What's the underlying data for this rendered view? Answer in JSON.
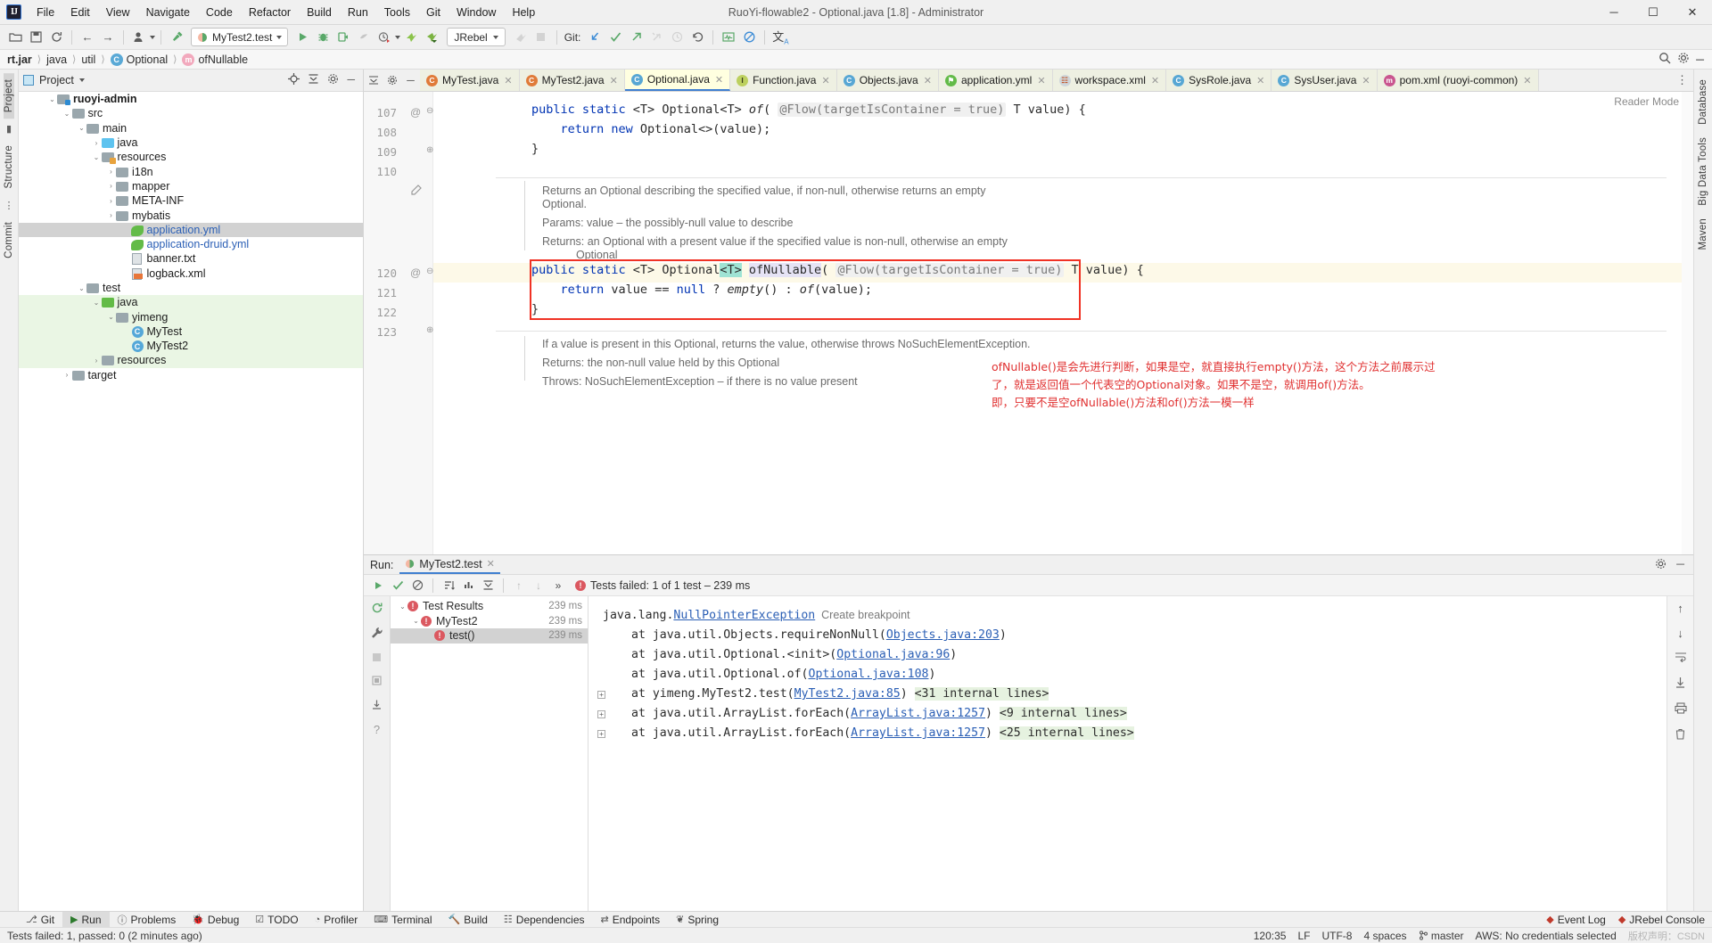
{
  "window": {
    "title": "RuoYi-flowable2 - Optional.java [1.8] - Administrator",
    "logo": "IJ",
    "minimize": "─",
    "maximize": "☐",
    "close": "✕"
  },
  "menubar": [
    "File",
    "Edit",
    "View",
    "Navigate",
    "Code",
    "Refactor",
    "Build",
    "Run",
    "Tools",
    "Git",
    "Window",
    "Help"
  ],
  "toolbar": {
    "run_config": "MyTest2.test",
    "jrebel": "JRebel",
    "git_label": "Git:",
    "icons": [
      "open-folder-icon",
      "save-icon",
      "sync-icon",
      "back-arrow-icon",
      "forward-arrow-icon",
      "user-avatar-icon",
      "build-hammer-icon",
      "run-icon",
      "debug-icon",
      "run-coverage-icon",
      "profiler-icon",
      "run-with-profiler-icon",
      "jrebel-run-icon",
      "jrebel-debug-icon",
      "attach-icon",
      "stop-icon",
      "git-update-icon",
      "git-commit-icon",
      "git-push-icon",
      "git-shelve-icon",
      "history-icon",
      "rollback-icon",
      "activity-monitor-icon",
      "no-access-icon",
      "translate-icon"
    ]
  },
  "breadcrumb": {
    "items": [
      "rt.jar",
      "java",
      "util",
      "Optional",
      "ofNullable"
    ],
    "right_icons": [
      "search-icon",
      "gear-icon",
      "more-icon"
    ]
  },
  "left_rail": {
    "top": [
      "Project",
      "Structure",
      "Commit"
    ],
    "selected": "Project"
  },
  "right_rail": {
    "items": [
      "Database",
      "Big Data Tools",
      "Maven"
    ]
  },
  "project_panel": {
    "title": "Project",
    "tree": [
      {
        "indent": 0,
        "arrow": "⌄",
        "icon": "folder-module-icon",
        "label": "ruoyi-admin",
        "bold": true,
        "sel": false,
        "green": false
      },
      {
        "indent": 1,
        "arrow": "⌄",
        "icon": "folder-icon",
        "label": "src",
        "bold": false,
        "sel": false,
        "green": false
      },
      {
        "indent": 2,
        "arrow": "⌄",
        "icon": "folder-icon",
        "label": "main",
        "bold": false,
        "sel": false,
        "green": false
      },
      {
        "indent": 3,
        "arrow": "›",
        "icon": "folder-source-icon",
        "label": "java",
        "bold": false,
        "sel": false,
        "green": false
      },
      {
        "indent": 3,
        "arrow": "⌄",
        "icon": "folder-resources-icon",
        "label": "resources",
        "bold": false,
        "sel": false,
        "green": false
      },
      {
        "indent": 4,
        "arrow": "›",
        "icon": "folder-icon",
        "label": "i18n",
        "bold": false,
        "sel": false,
        "green": false
      },
      {
        "indent": 4,
        "arrow": "›",
        "icon": "folder-icon",
        "label": "mapper",
        "bold": false,
        "sel": false,
        "green": false
      },
      {
        "indent": 4,
        "arrow": "›",
        "icon": "folder-icon",
        "label": "META-INF",
        "bold": false,
        "sel": false,
        "green": false
      },
      {
        "indent": 4,
        "arrow": "›",
        "icon": "folder-icon",
        "label": "mybatis",
        "bold": false,
        "sel": false,
        "green": false
      },
      {
        "indent": 5,
        "arrow": "",
        "icon": "yaml-file-icon",
        "label": "application.yml",
        "bold": false,
        "sel": true,
        "green": false,
        "link": true
      },
      {
        "indent": 5,
        "arrow": "",
        "icon": "yaml-file-icon",
        "label": "application-druid.yml",
        "bold": false,
        "sel": false,
        "green": false,
        "link": true
      },
      {
        "indent": 5,
        "arrow": "",
        "icon": "text-file-icon",
        "label": "banner.txt",
        "bold": false,
        "sel": false,
        "green": false
      },
      {
        "indent": 5,
        "arrow": "",
        "icon": "xml-file-icon",
        "label": "logback.xml",
        "bold": false,
        "sel": false,
        "green": false
      },
      {
        "indent": 2,
        "arrow": "⌄",
        "icon": "folder-icon",
        "label": "test",
        "bold": false,
        "sel": false,
        "green": false
      },
      {
        "indent": 3,
        "arrow": "⌄",
        "icon": "folder-test-source-icon",
        "label": "java",
        "bold": false,
        "sel": false,
        "green": true
      },
      {
        "indent": 4,
        "arrow": "⌄",
        "icon": "folder-icon",
        "label": "yimeng",
        "bold": false,
        "sel": false,
        "green": true
      },
      {
        "indent": 5,
        "arrow": "",
        "icon": "java-class-icon",
        "label": "MyTest",
        "bold": false,
        "sel": false,
        "green": true
      },
      {
        "indent": 5,
        "arrow": "",
        "icon": "java-class-icon",
        "label": "MyTest2",
        "bold": false,
        "sel": false,
        "green": true
      },
      {
        "indent": 3,
        "arrow": "›",
        "icon": "folder-icon",
        "label": "resources",
        "bold": false,
        "sel": false,
        "green": true
      },
      {
        "indent": 1,
        "arrow": "›",
        "icon": "folder-excluded-icon",
        "label": "target",
        "bold": false,
        "sel": false,
        "green": false
      }
    ]
  },
  "editor": {
    "tabs": [
      {
        "label": "MyTest.java",
        "icon": "java-class-run-icon",
        "kind": "c",
        "active": false
      },
      {
        "label": "MyTest2.java",
        "icon": "java-class-run-icon",
        "kind": "c",
        "active": false
      },
      {
        "label": "Optional.java",
        "icon": "java-class-icon",
        "kind": "cb",
        "active": true
      },
      {
        "label": "Function.java",
        "icon": "java-interface-icon",
        "kind": "i",
        "active": false
      },
      {
        "label": "Objects.java",
        "icon": "java-class-icon",
        "kind": "cb",
        "active": false
      },
      {
        "label": "application.yml",
        "icon": "yaml-file-icon",
        "kind": "y",
        "active": false
      },
      {
        "label": "workspace.xml",
        "icon": "xml-file-icon",
        "kind": "x",
        "active": false
      },
      {
        "label": "SysRole.java",
        "icon": "java-class-icon",
        "kind": "cb",
        "active": false
      },
      {
        "label": "SysUser.java",
        "icon": "java-class-icon",
        "kind": "cb",
        "active": false
      },
      {
        "label": "pom.xml (ruoyi-common)",
        "icon": "maven-file-icon",
        "kind": "m",
        "active": false
      }
    ],
    "reader_mode": "Reader Mode",
    "line_numbers": [
      "107",
      "108",
      "109",
      "110",
      "120",
      "121",
      "122",
      "123"
    ],
    "javadoc_top": [
      "Returns an Optional describing the specified value, if non-null, otherwise returns an empty",
      "Optional.",
      "Params:  value – the possibly-null value to describe",
      "Returns: an Optional with a present value if the specified value is non-null, otherwise an empty",
      "Optional"
    ],
    "javadoc_bottom": [
      "If a value is present in this Optional, returns the value, otherwise throws NoSuchElementException.",
      "Returns:  the non-null value held by this Optional",
      "Throws:  NoSuchElementException – if there is no value present"
    ],
    "annotation_cn": [
      "ofNullable()是会先进行判断，如果是空，就直接执行empty()方法，这个方法之前展示过",
      "了，就是返回值一个代表空的Optional对象。如果不是空，就调用of()方法。",
      "即，只要不是空ofNullable()方法和of()方法一模一样"
    ]
  },
  "run_panel": {
    "label": "Run:",
    "tab": "MyTest2.test",
    "status": "Tests failed: 1 of 1 test – 239 ms",
    "tree": [
      {
        "indent": 0,
        "arrow": "⌄",
        "label": "Test Results",
        "time": "239 ms",
        "sel": false
      },
      {
        "indent": 1,
        "arrow": "⌄",
        "label": "MyTest2",
        "time": "239 ms",
        "sel": false
      },
      {
        "indent": 2,
        "arrow": "",
        "label": "test()",
        "time": "239 ms",
        "sel": true
      }
    ],
    "console": [
      {
        "indent": 0,
        "parts": [
          {
            "t": "java.lang.",
            "c": "exc"
          },
          {
            "t": "NullPointerException",
            "c": "lnk"
          },
          {
            "t": "  Create breakpoint",
            "c": "bpt"
          }
        ]
      },
      {
        "indent": 1,
        "parts": [
          {
            "t": "at java.util.Objects.requireNonNull(",
            "c": "exc"
          },
          {
            "t": "Objects.java:203",
            "c": "lnk"
          },
          {
            "t": ")",
            "c": "exc"
          }
        ]
      },
      {
        "indent": 1,
        "parts": [
          {
            "t": "at java.util.Optional.<init>(",
            "c": "exc"
          },
          {
            "t": "Optional.java:96",
            "c": "lnk"
          },
          {
            "t": ")",
            "c": "exc"
          }
        ]
      },
      {
        "indent": 1,
        "parts": [
          {
            "t": "at java.util.Optional.of(",
            "c": "exc"
          },
          {
            "t": "Optional.java:108",
            "c": "lnk"
          },
          {
            "t": ")",
            "c": "exc"
          }
        ]
      },
      {
        "indent": 1,
        "fold": true,
        "parts": [
          {
            "t": "at yimeng.MyTest2.test(",
            "c": "exc"
          },
          {
            "t": "MyTest2.java:85",
            "c": "lnk"
          },
          {
            "t": ") ",
            "c": "exc"
          },
          {
            "t": "<31 internal lines>",
            "c": "ilines"
          }
        ]
      },
      {
        "indent": 1,
        "fold": true,
        "parts": [
          {
            "t": "at java.util.ArrayList.forEach(",
            "c": "exc"
          },
          {
            "t": "ArrayList.java:1257",
            "c": "lnk"
          },
          {
            "t": ") ",
            "c": "exc"
          },
          {
            "t": "<9 internal lines>",
            "c": "ilines"
          }
        ]
      },
      {
        "indent": 1,
        "fold": true,
        "parts": [
          {
            "t": "at java.util.ArrayList.forEach(",
            "c": "exc"
          },
          {
            "t": "ArrayList.java:1257",
            "c": "lnk"
          },
          {
            "t": ") ",
            "c": "exc"
          },
          {
            "t": "<25 internal lines>",
            "c": "ilines"
          }
        ]
      }
    ]
  },
  "tool_windows": {
    "items": [
      {
        "label": "Git",
        "icon": "git-icon",
        "active": false
      },
      {
        "label": "Run",
        "icon": "run-icon",
        "active": true
      },
      {
        "label": "Problems",
        "icon": "problems-icon",
        "active": false
      },
      {
        "label": "Debug",
        "icon": "debug-icon",
        "active": false
      },
      {
        "label": "TODO",
        "icon": "todo-icon",
        "active": false
      },
      {
        "label": "Profiler",
        "icon": "profiler-icon",
        "active": false
      },
      {
        "label": "Terminal",
        "icon": "terminal-icon",
        "active": false
      },
      {
        "label": "Build",
        "icon": "build-icon",
        "active": false
      },
      {
        "label": "Dependencies",
        "icon": "dependencies-icon",
        "active": false
      },
      {
        "label": "Endpoints",
        "icon": "endpoints-icon",
        "active": false
      },
      {
        "label": "Spring",
        "icon": "spring-icon",
        "active": false
      }
    ],
    "right": [
      {
        "label": "Event Log",
        "icon": "event-log-icon"
      },
      {
        "label": "JRebel Console",
        "icon": "jrebel-icon"
      }
    ]
  },
  "status_bar": {
    "message": "Tests failed: 1, passed: 0 (2 minutes ago)",
    "caret": "120:35",
    "line_sep": "LF",
    "encoding": "UTF-8",
    "indent": "4 spaces",
    "branch": "master",
    "aws": "AWS: No credentials selected",
    "watermark": "版权声明：CSDN"
  },
  "colors": {
    "accent": "#3f7fd0",
    "error": "#db5860",
    "annotation_red": "#e03030",
    "keyword": "#0033b3",
    "string": "#067d17",
    "selected_tab": "#ffffe0"
  }
}
